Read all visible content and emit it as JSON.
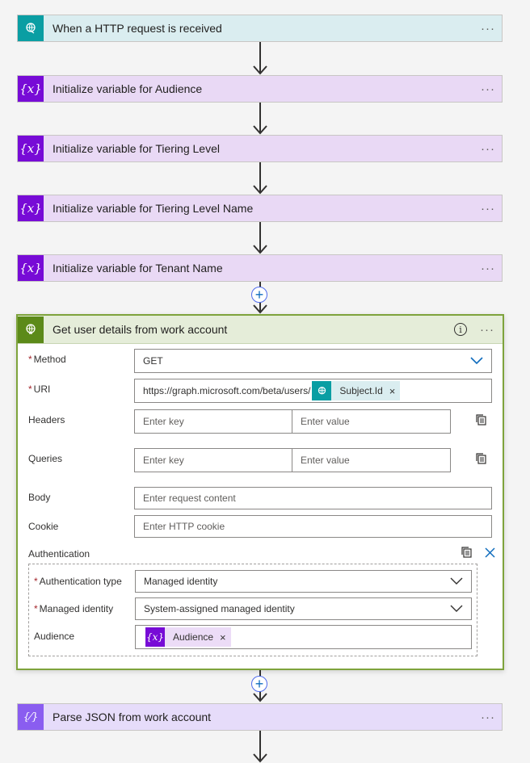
{
  "steps": {
    "trigger": {
      "title": "When a HTTP request is received",
      "more": "···"
    },
    "var1": {
      "title": "Initialize variable for Audience",
      "more": "···",
      "icon": "{x}"
    },
    "var2": {
      "title": "Initialize variable for Tiering Level",
      "more": "···",
      "icon": "{x}"
    },
    "var3": {
      "title": "Initialize variable for Tiering Level Name",
      "more": "···",
      "icon": "{x}"
    },
    "var4": {
      "title": "Initialize variable for Tenant Name",
      "more": "···",
      "icon": "{x}"
    },
    "parse": {
      "title": "Parse JSON from work account",
      "more": "···",
      "icon": "{⁄}"
    }
  },
  "http_action": {
    "title": "Get user details from work account",
    "info": "i",
    "more": "···",
    "method": {
      "label": "Method",
      "required": "*",
      "value": "GET"
    },
    "uri": {
      "label": "URI",
      "required": "*",
      "value": "https://graph.microsoft.com/beta/users/",
      "token": "Subject.Id",
      "token_remove": "×"
    },
    "headers": {
      "label": "Headers",
      "key_placeholder": "Enter key",
      "value_placeholder": "Enter value"
    },
    "queries": {
      "label": "Queries",
      "key_placeholder": "Enter key",
      "value_placeholder": "Enter value"
    },
    "body": {
      "label": "Body",
      "placeholder": "Enter request content"
    },
    "cookie": {
      "label": "Cookie",
      "placeholder": "Enter HTTP cookie"
    },
    "authentication": {
      "label": "Authentication",
      "type": {
        "label": "Authentication type",
        "required": "*",
        "value": "Managed identity"
      },
      "identity": {
        "label": "Managed identity",
        "required": "*",
        "value": "System-assigned managed identity"
      },
      "audience": {
        "label": "Audience",
        "token": "Audience",
        "token_icon": "{x}",
        "token_remove": "×"
      }
    }
  },
  "add_step": "+",
  "colors": {
    "trigger": "#0a9ea3",
    "variable": "#770bd6",
    "http": "#5c8a19",
    "parse": "#8a5df0"
  }
}
